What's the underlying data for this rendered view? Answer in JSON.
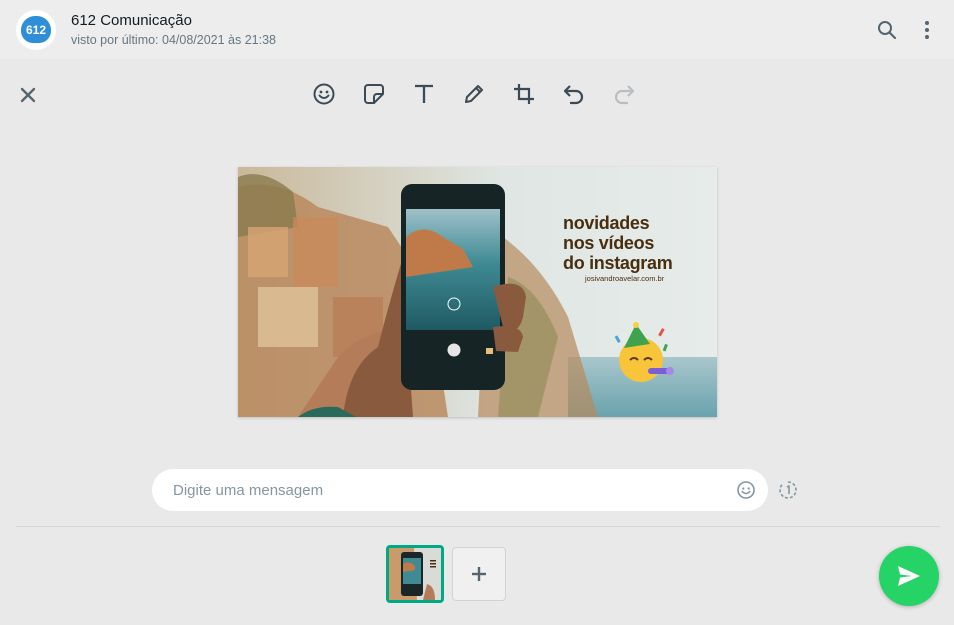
{
  "header": {
    "avatar_text": "612",
    "contact_name": "612 Comunicação",
    "last_seen": "visto por último: 04/08/2021 às 21:38",
    "icons": [
      "search-icon",
      "menu-icon"
    ]
  },
  "toolbar": {
    "tools": [
      "emoji-icon",
      "sticker-icon",
      "text-icon",
      "pencil-icon",
      "crop-icon",
      "undo-icon",
      "redo-icon"
    ]
  },
  "preview": {
    "headline_1": "novidades",
    "headline_2": "nos vídeos",
    "headline_3": "do instagram",
    "url": "josivandroavelar.com.br",
    "icons": [
      "party-face-icon"
    ]
  },
  "message": {
    "placeholder": "Digite uma mensagem",
    "icons": [
      "emoji-icon",
      "view-once-icon"
    ]
  },
  "footer": {
    "icons": [
      "add-icon",
      "send-icon"
    ]
  },
  "colors": {
    "accent": "#00a884",
    "send": "#25d366",
    "background": "#e9e9e9"
  }
}
